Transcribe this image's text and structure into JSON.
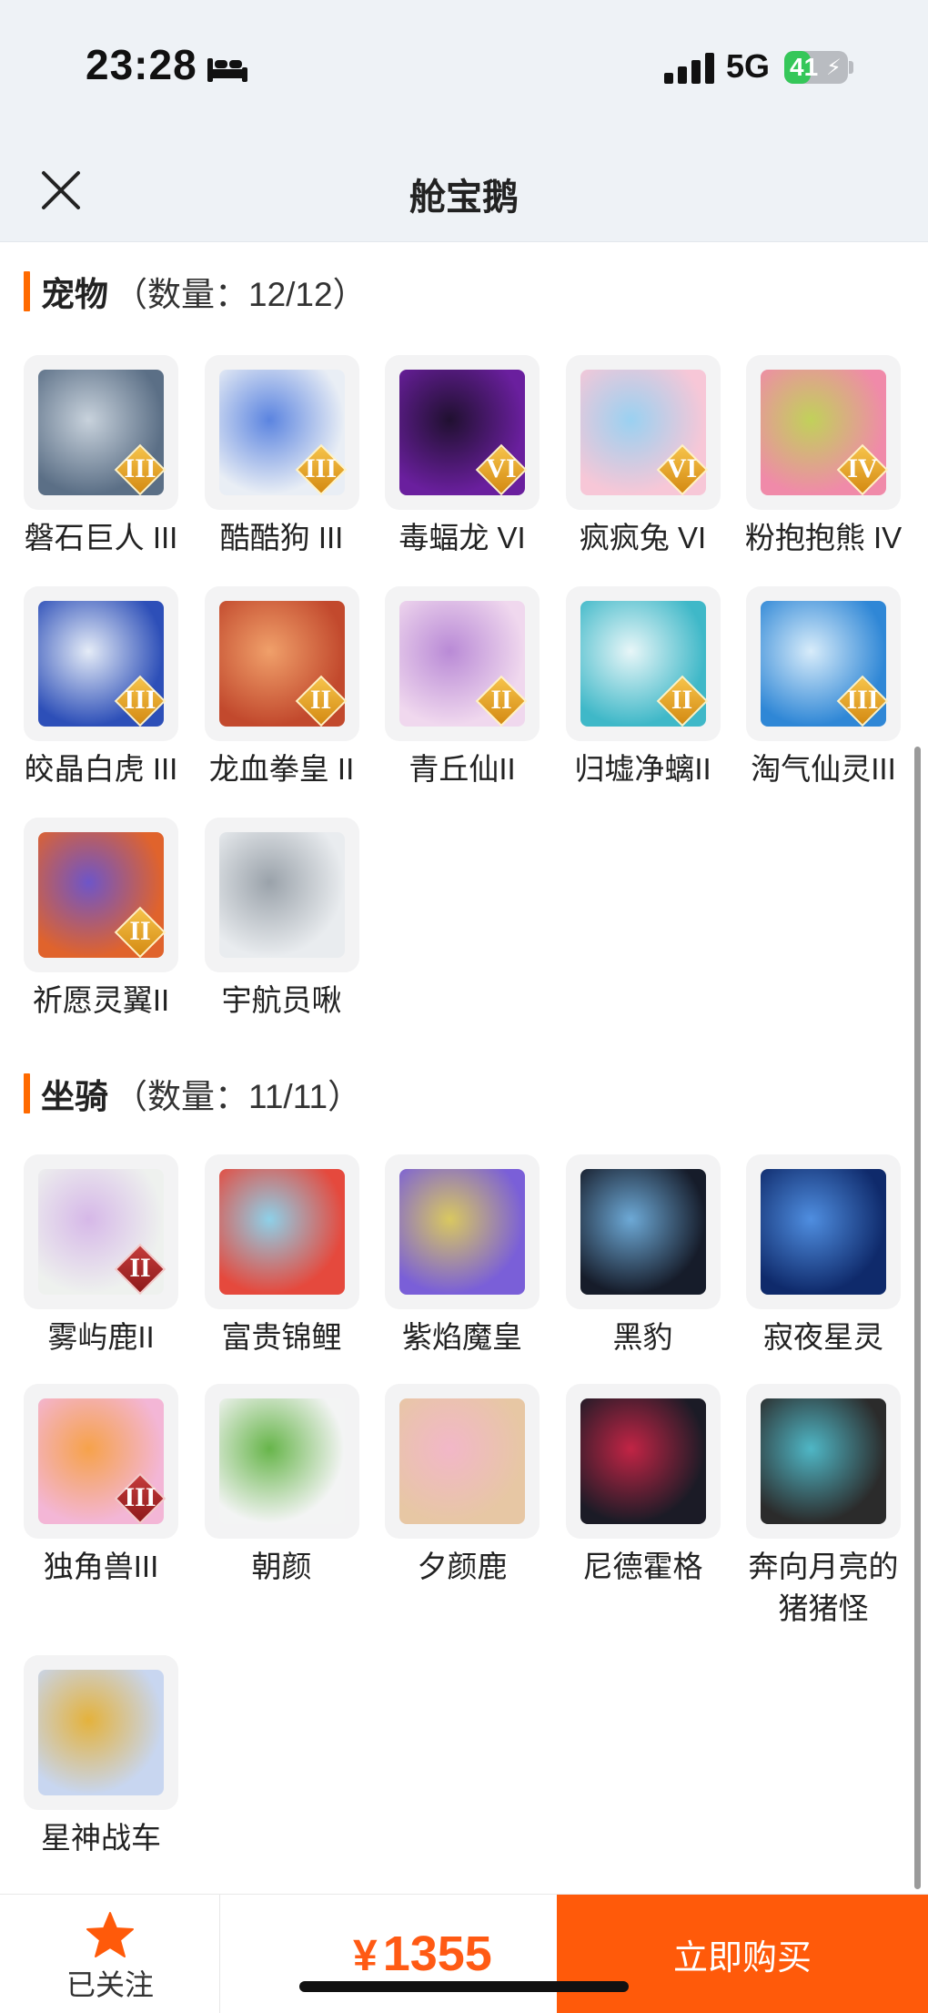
{
  "status": {
    "time": "23:28",
    "network": "5G",
    "battery": "41",
    "battery_level": 0.41
  },
  "header": {
    "title": "舱宝鹅"
  },
  "sections": [
    {
      "name": "宠物",
      "count": "（数量：12/12）",
      "items": [
        {
          "label": "磐石巨人 III",
          "badge": "III",
          "colors": [
            "#5b6f86",
            "#c8d2dc"
          ]
        },
        {
          "label": "酷酷狗 III",
          "badge": "III",
          "colors": [
            "#e9eef5",
            "#5b84e0"
          ]
        },
        {
          "label": "毒蝠龙 VI",
          "badge": "VI",
          "colors": [
            "#6a1f9e",
            "#201030"
          ]
        },
        {
          "label": "疯疯兔 VI",
          "badge": "VI",
          "colors": [
            "#f7c7d7",
            "#9ad1f1"
          ]
        },
        {
          "label": "粉抱抱熊 IV",
          "badge": "IV",
          "colors": [
            "#f08aa9",
            "#c1d15a"
          ]
        },
        {
          "label": "皎晶白虎 III",
          "badge": "III",
          "colors": [
            "#2d4fb8",
            "#e5ecf7"
          ]
        },
        {
          "label": "龙血拳皇 II",
          "badge": "II",
          "colors": [
            "#c2492d",
            "#f0a06a"
          ]
        },
        {
          "label": "青丘仙II",
          "badge": "II",
          "colors": [
            "#f0d8ee",
            "#b98ad6"
          ]
        },
        {
          "label": "归墟净螭II",
          "badge": "II",
          "colors": [
            "#3fb8c8",
            "#e8f6f8"
          ]
        },
        {
          "label": "淘气仙灵III",
          "badge": "III",
          "colors": [
            "#2f87d6",
            "#d8ecfa"
          ]
        },
        {
          "label": "祈愿灵翼II",
          "badge": "II",
          "colors": [
            "#e0632c",
            "#6e55c8"
          ]
        },
        {
          "label": "宇航员啾",
          "badge": "",
          "colors": [
            "#e9ecef",
            "#9aa2aa"
          ]
        }
      ]
    },
    {
      "name": "坐骑",
      "count": "（数量：11/11）",
      "items": [
        {
          "label": "雾屿鹿II",
          "badge": "II",
          "badge_style": "red",
          "colors": [
            "#eef1ee",
            "#d6b8e8"
          ]
        },
        {
          "label": "富贵锦鲤",
          "badge": "",
          "colors": [
            "#e5493d",
            "#8ed0e8"
          ]
        },
        {
          "label": "紫焰魔皇",
          "badge": "",
          "colors": [
            "#7a5fd8",
            "#d9c860"
          ]
        },
        {
          "label": "黑豹",
          "badge": "",
          "colors": [
            "#161c2a",
            "#6da9d6"
          ]
        },
        {
          "label": "寂夜星灵",
          "badge": "",
          "colors": [
            "#0f2a6b",
            "#4f8ee0"
          ]
        },
        {
          "label": "独角兽III",
          "badge": "III",
          "badge_style": "red",
          "colors": [
            "#f3b6d6",
            "#f6a24a"
          ]
        },
        {
          "label": "朝颜",
          "badge": "",
          "colors": [
            "#f3f4f4",
            "#67b54a"
          ]
        },
        {
          "label": "夕颜鹿",
          "badge": "",
          "colors": [
            "#e7c7a4",
            "#f2b7c8"
          ]
        },
        {
          "label": "尼德霍格",
          "badge": "",
          "colors": [
            "#1b1b26",
            "#c22445"
          ]
        },
        {
          "label": "奔向月亮的猪猪怪",
          "badge": "",
          "colors": [
            "#2b2b2b",
            "#4fb7c6"
          ]
        },
        {
          "label": "星神战车",
          "badge": "",
          "colors": [
            "#c8d6f0",
            "#e4b23c"
          ]
        }
      ]
    }
  ],
  "bottom": {
    "follow_label": "已关注",
    "currency": "¥",
    "price": "1355",
    "buy_label": "立即购买"
  },
  "colors": {
    "accent": "#ff5a0a",
    "price": "#ff5a14",
    "section_bar": "#ff6a00"
  }
}
